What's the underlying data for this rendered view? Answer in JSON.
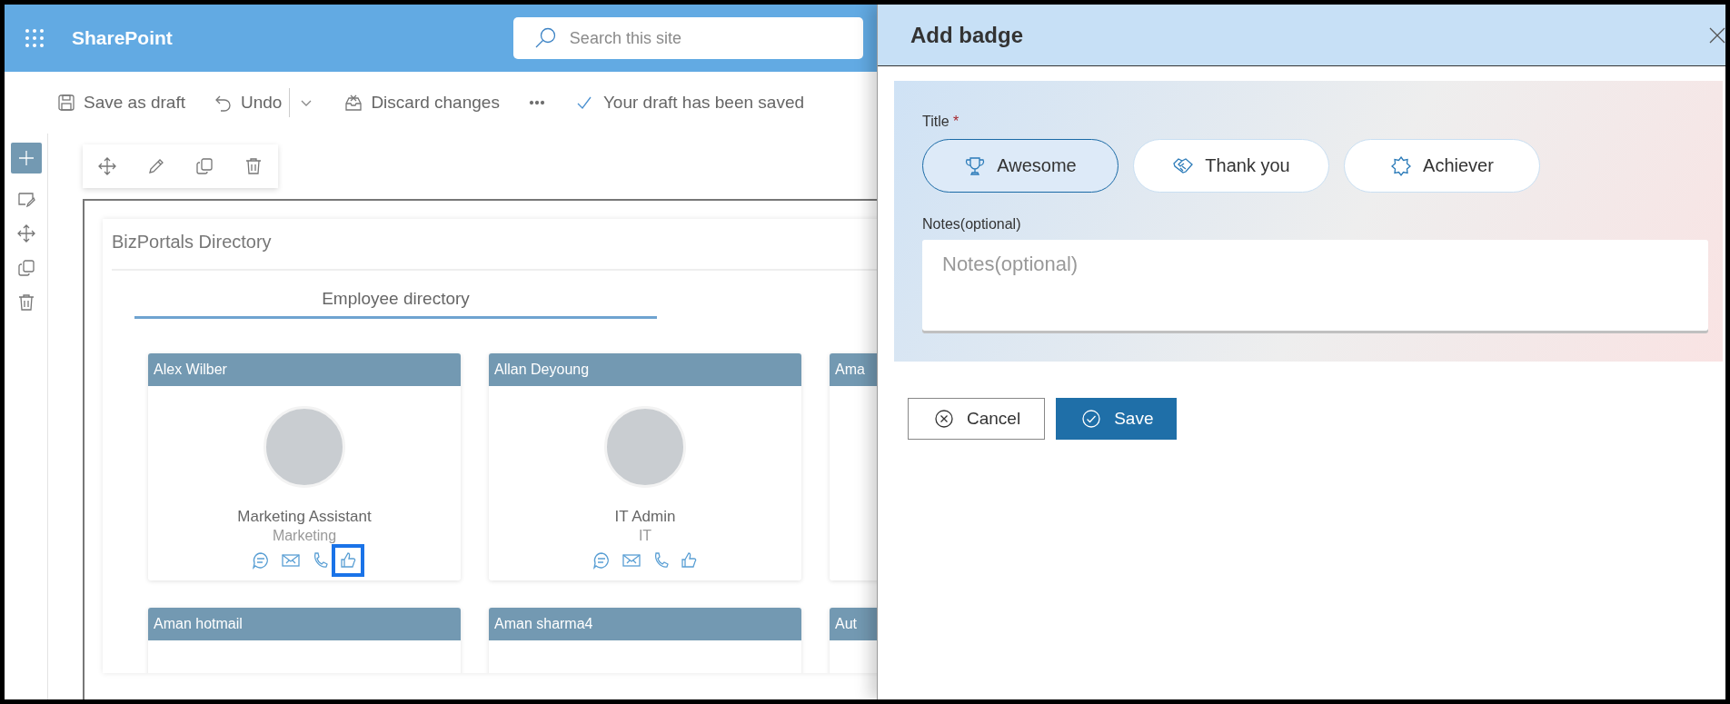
{
  "header": {
    "app_name": "SharePoint",
    "search_placeholder": "Search this site"
  },
  "command_bar": {
    "items": [
      {
        "kind": "save",
        "label": "Save as draft"
      },
      {
        "kind": "undo",
        "label": "Undo"
      },
      {
        "kind": "discard",
        "label": "Discard changes"
      },
      {
        "kind": "more"
      }
    ],
    "status": "Your draft has been saved"
  },
  "webpart": {
    "title": "BizPortals Directory",
    "tabs": [
      {
        "label": "Employee directory",
        "selected": true
      }
    ],
    "cards": [
      {
        "name": "Alex Wilber",
        "job_title": "Marketing Assistant",
        "department": "Marketing",
        "like_highlighted": true
      },
      {
        "name": "Allan Deyoung",
        "job_title": "IT Admin",
        "department": "IT",
        "like_highlighted": false
      },
      {
        "name": "Ama"
      },
      {
        "name": "Aman hotmail"
      },
      {
        "name": "Aman sharma4"
      },
      {
        "name": "Aut"
      }
    ]
  },
  "panel": {
    "title": "Add badge",
    "title_label": "Title",
    "required_mark": "*",
    "badges": [
      {
        "kind": "trophy",
        "label": "Awesome",
        "selected": true
      },
      {
        "kind": "handshake",
        "label": "Thank you",
        "selected": false
      },
      {
        "kind": "star",
        "label": "Achiever",
        "selected": false
      }
    ],
    "notes_label": "Notes(optional)",
    "notes_placeholder": "Notes(optional)",
    "buttons": [
      {
        "kind": "cancel",
        "label": "Cancel"
      },
      {
        "kind": "save",
        "label": "Save"
      }
    ]
  }
}
